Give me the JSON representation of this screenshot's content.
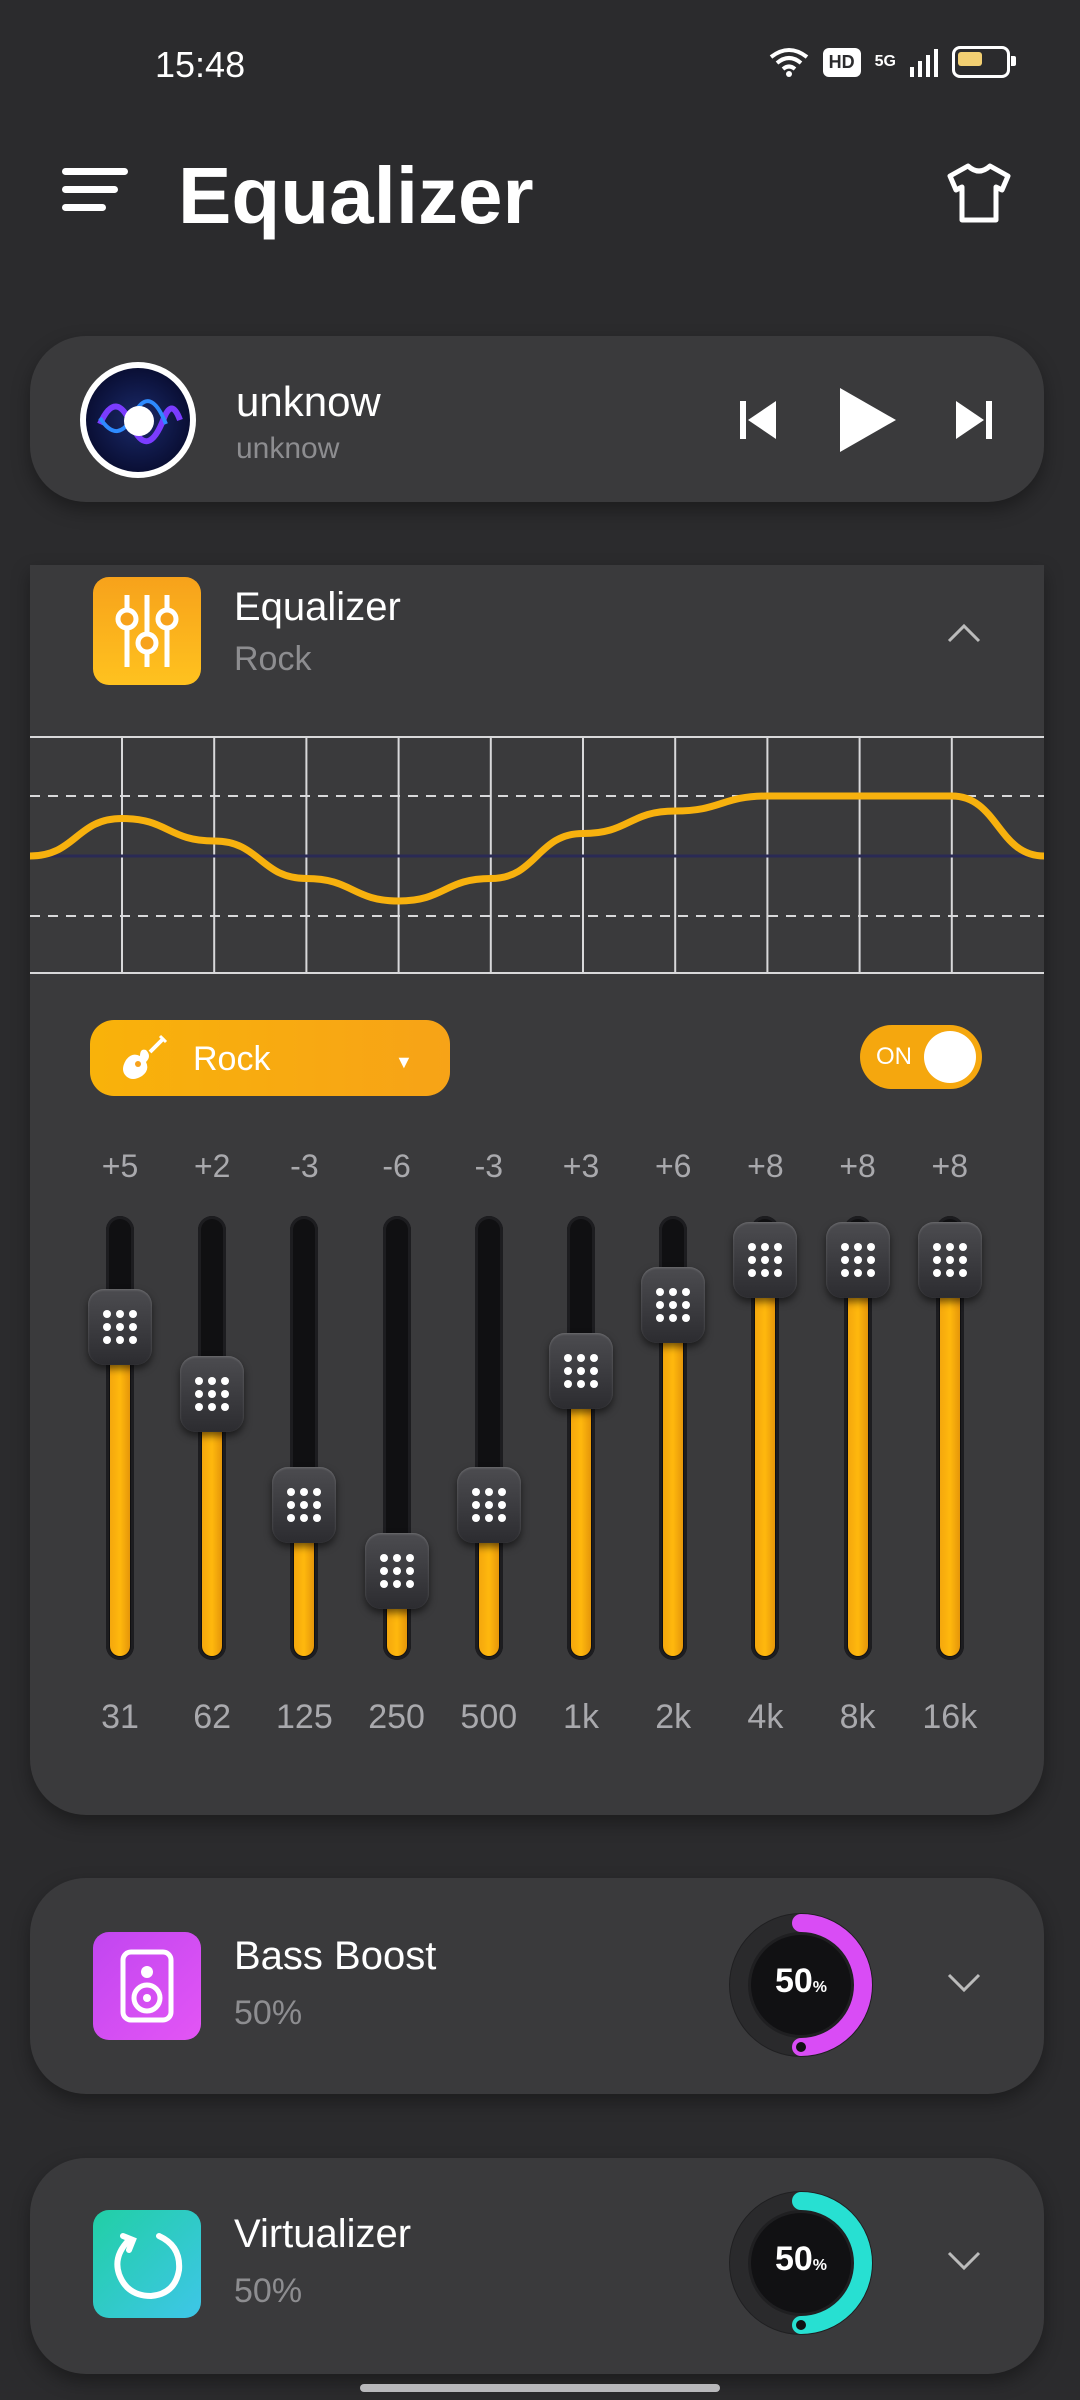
{
  "status_bar": {
    "time": "15:48",
    "network": "5G",
    "hd_badge": "HD"
  },
  "header": {
    "title": "Equalizer",
    "menu_icon": "menu-icon",
    "theme_icon": "tshirt-icon"
  },
  "player": {
    "title": "unknow",
    "artist": "unknow",
    "controls": [
      "previous-icon",
      "play-icon",
      "next-icon"
    ]
  },
  "equalizer": {
    "title": "Equalizer",
    "preset": "Rock",
    "preset_button_label": "Rock",
    "toggle_label": "ON",
    "enabled": true,
    "bands": [
      {
        "freq": "31",
        "value_label": "+5",
        "value": 5
      },
      {
        "freq": "62",
        "value_label": "+2",
        "value": 2
      },
      {
        "freq": "125",
        "value_label": "-3",
        "value": -3
      },
      {
        "freq": "250",
        "value_label": "-6",
        "value": -6
      },
      {
        "freq": "500",
        "value_label": "-3",
        "value": -3
      },
      {
        "freq": "1k",
        "value_label": "+3",
        "value": 3
      },
      {
        "freq": "2k",
        "value_label": "+6",
        "value": 6
      },
      {
        "freq": "4k",
        "value_label": "+8",
        "value": 8
      },
      {
        "freq": "8k",
        "value_label": "+8",
        "value": 8
      },
      {
        "freq": "16k",
        "value_label": "+8",
        "value": 8
      }
    ],
    "accent_color": "#f7a90e"
  },
  "bass_boost": {
    "title": "Bass Boost",
    "subtitle": "50%",
    "knob_value": "50",
    "knob_unit": "%",
    "level": 0.5,
    "color": "#d94cf5"
  },
  "virtualizer": {
    "title": "Virtualizer",
    "subtitle": "50%",
    "knob_value": "50",
    "knob_unit": "%",
    "level": 0.5,
    "color": "#27e0d2"
  }
}
